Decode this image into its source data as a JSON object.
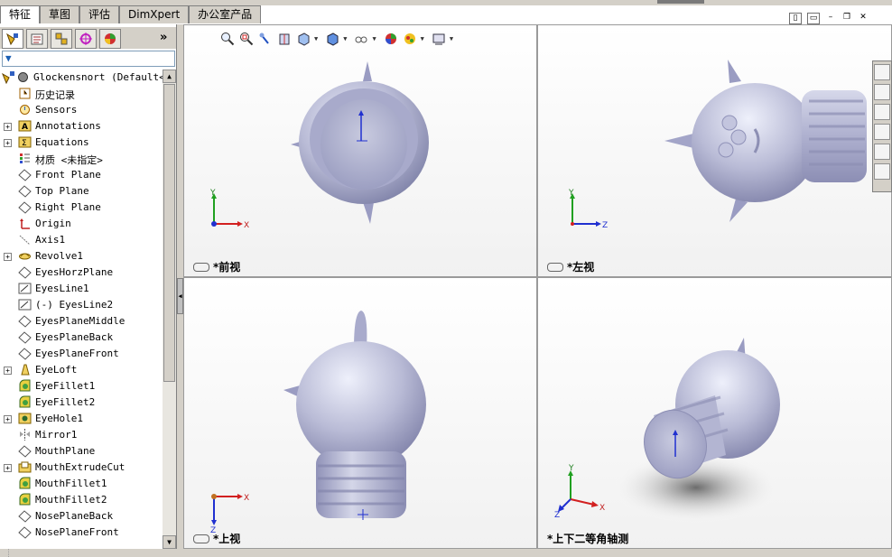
{
  "tabs": [
    {
      "label": "特征",
      "active": true
    },
    {
      "label": "草图",
      "active": false
    },
    {
      "label": "评估",
      "active": false
    },
    {
      "label": "DimXpert",
      "active": false
    },
    {
      "label": "办公室产品",
      "active": false
    }
  ],
  "panel": {
    "expand_arrow": "»",
    "filter_icon": "funnel-icon"
  },
  "tree": {
    "root": "Glockensnort  (Default<<",
    "items": [
      {
        "label": "历史记录",
        "icon": "history-icon",
        "expand": false
      },
      {
        "label": "Sensors",
        "icon": "sensor-icon",
        "expand": false
      },
      {
        "label": "Annotations",
        "icon": "annotation-icon",
        "expand": true
      },
      {
        "label": "Equations",
        "icon": "equation-icon",
        "expand": true
      },
      {
        "label": "材质 <未指定>",
        "icon": "material-icon",
        "expand": false
      },
      {
        "label": "Front Plane",
        "icon": "plane-icon",
        "expand": false
      },
      {
        "label": "Top Plane",
        "icon": "plane-icon",
        "expand": false
      },
      {
        "label": "Right Plane",
        "icon": "plane-icon",
        "expand": false
      },
      {
        "label": "Origin",
        "icon": "origin-icon",
        "expand": false
      },
      {
        "label": "Axis1",
        "icon": "axis-icon",
        "expand": false
      },
      {
        "label": "Revolve1",
        "icon": "revolve-icon",
        "expand": true
      },
      {
        "label": "EyesHorzPlane",
        "icon": "plane-icon",
        "expand": false
      },
      {
        "label": "EyesLine1",
        "icon": "sketch-icon",
        "expand": false
      },
      {
        "label": "(-) EyesLine2",
        "icon": "sketch-icon",
        "expand": false
      },
      {
        "label": "EyesPlaneMiddle",
        "icon": "plane-icon",
        "expand": false
      },
      {
        "label": "EyesPlaneBack",
        "icon": "plane-icon",
        "expand": false
      },
      {
        "label": "EyesPlaneFront",
        "icon": "plane-icon",
        "expand": false
      },
      {
        "label": "EyeLoft",
        "icon": "loft-icon",
        "expand": true
      },
      {
        "label": "EyeFillet1",
        "icon": "fillet-icon",
        "expand": false
      },
      {
        "label": "EyeFillet2",
        "icon": "fillet-icon",
        "expand": false
      },
      {
        "label": "EyeHole1",
        "icon": "hole-icon",
        "expand": true
      },
      {
        "label": "Mirror1",
        "icon": "mirror-icon",
        "expand": false
      },
      {
        "label": "MouthPlane",
        "icon": "plane-icon",
        "expand": false
      },
      {
        "label": "MouthExtrudeCut",
        "icon": "cut-icon",
        "expand": true
      },
      {
        "label": "MouthFillet1",
        "icon": "fillet-icon",
        "expand": false
      },
      {
        "label": "MouthFillet2",
        "icon": "fillet-icon",
        "expand": false
      },
      {
        "label": "NosePlaneBack",
        "icon": "plane-icon",
        "expand": false
      },
      {
        "label": "NosePlaneFront",
        "icon": "plane-icon",
        "expand": false
      }
    ]
  },
  "viewports": {
    "front": {
      "label": "*前视"
    },
    "left": {
      "label": "*左视"
    },
    "top": {
      "label": "*上视"
    },
    "iso": {
      "label": "*上下二等角轴测"
    }
  },
  "triad_labels": {
    "x": "X",
    "y": "Y",
    "z": "Z"
  },
  "colors": {
    "model": "#b9bbd6",
    "model_dark": "#8d8fb4",
    "axis_x": "#d22020",
    "axis_y": "#20a020",
    "axis_z": "#2030d0"
  }
}
